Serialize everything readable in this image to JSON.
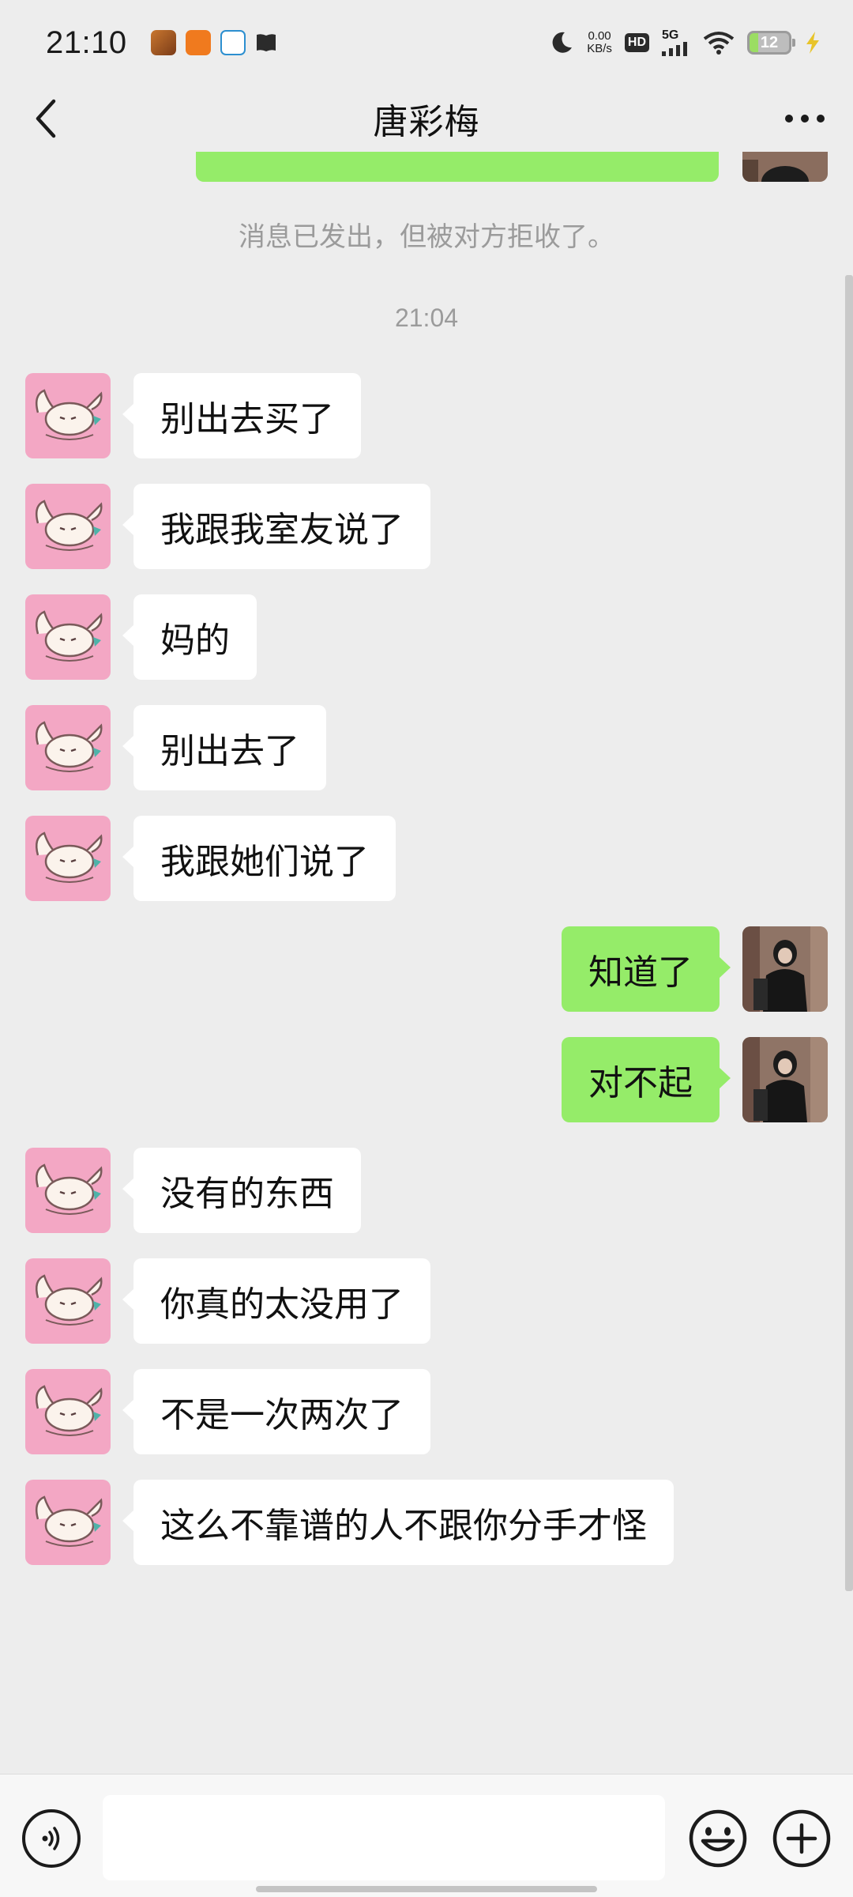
{
  "status_bar": {
    "time": "21:10",
    "net_speed_value": "0.00",
    "net_speed_unit": "KB/s",
    "hd_label": "HD",
    "network_label": "5G",
    "battery_level": "12"
  },
  "header": {
    "title": "唐彩梅"
  },
  "chat": {
    "system_notice": "消息已发出，但被对方拒收了。",
    "timestamp": "21:04",
    "messages": [
      {
        "side": "left",
        "text": "别出去买了"
      },
      {
        "side": "left",
        "text": "我跟我室友说了"
      },
      {
        "side": "left",
        "text": "妈的"
      },
      {
        "side": "left",
        "text": "别出去了"
      },
      {
        "side": "left",
        "text": "我跟她们说了"
      },
      {
        "side": "right",
        "text": "知道了"
      },
      {
        "side": "right",
        "text": "对不起"
      },
      {
        "side": "left",
        "text": "没有的东西"
      },
      {
        "side": "left",
        "text": "你真的太没用了"
      },
      {
        "side": "left",
        "text": "不是一次两次了"
      },
      {
        "side": "left",
        "text": "这么不靠谱的人不跟你分手才怪"
      }
    ]
  },
  "input_bar": {
    "placeholder": "",
    "value": ""
  },
  "colors": {
    "background": "#ededed",
    "sent_bubble": "#95ec69",
    "received_bubble": "#ffffff",
    "contact_avatar_bg": "#f3a7c4"
  },
  "icons": {
    "back": "chevron-left-icon",
    "more": "ellipsis-icon",
    "voice": "voice-icon",
    "emoji": "smiley-icon",
    "plus": "plus-icon"
  }
}
